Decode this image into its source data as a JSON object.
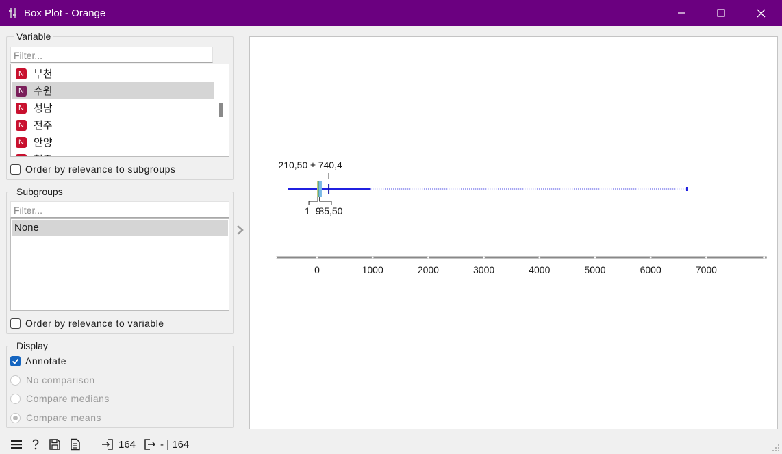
{
  "window": {
    "title": "Box Plot - Orange",
    "titlebar_color": "#6b0080"
  },
  "variable_panel": {
    "title": "Variable",
    "filter_placeholder": "Filter...",
    "type_badge": "N",
    "items": [
      "부천",
      "수원",
      "성남",
      "전주",
      "안양",
      "천주"
    ],
    "selected_item": "수원",
    "order_by_relevance_label": "Order by relevance to subgroups",
    "order_by_relevance_checked": false
  },
  "subgroups_panel": {
    "title": "Subgroups",
    "filter_placeholder": "Filter...",
    "items": [
      "None"
    ],
    "selected_item": "None",
    "order_by_relevance_label": "Order by relevance to variable",
    "order_by_relevance_checked": false
  },
  "display_panel": {
    "title": "Display",
    "annotate_label": "Annotate",
    "annotate_checked": true,
    "options": [
      {
        "label": "No comparison",
        "selected": false
      },
      {
        "label": "Compare medians",
        "selected": false
      },
      {
        "label": "Compare means",
        "selected": true
      }
    ]
  },
  "chart_data": {
    "type": "box",
    "orientation": "horizontal",
    "axis_ticks": [
      0,
      1000,
      2000,
      3000,
      4000,
      5000,
      6000,
      7000
    ],
    "xlim": [
      -1050,
      8100
    ],
    "whisker_min": -520,
    "q1": 1,
    "median": 9,
    "q3": 85.5,
    "mean": 210.5,
    "sd": 740.4,
    "whisker_max": 1000,
    "max": 6650,
    "mean_label": "210,50 ± 740,4",
    "q1_label": "1",
    "median_label": "9",
    "q3_label": "85,50",
    "colors": {
      "whisker": "#2020e0",
      "box_left": "#e6c94a",
      "box_right": "#7ab8e6",
      "median": "#3a9a3a",
      "axis": "#888888"
    }
  },
  "status_bar": {
    "input_count": "164",
    "output_text": "- | 164"
  }
}
